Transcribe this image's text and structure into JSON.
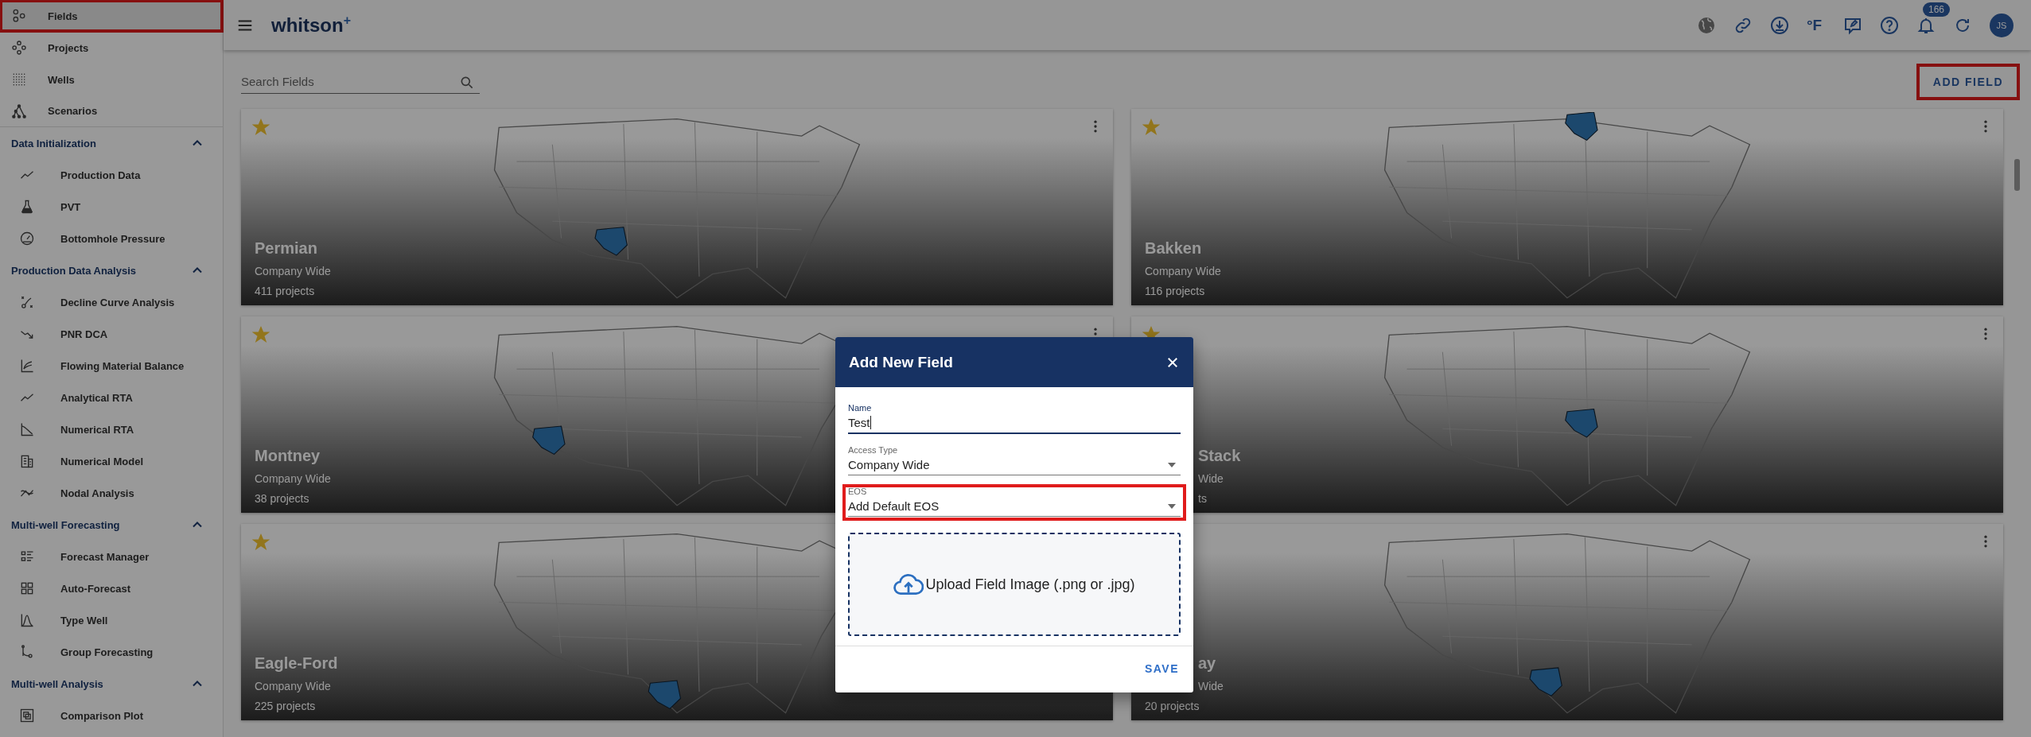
{
  "topbar": {
    "logo": "whitson$^{+}$",
    "units": "°F",
    "notifications": "166",
    "avatar": "JS"
  },
  "sidebar": {
    "top_items": [
      {
        "label": "Fields",
        "selected": true,
        "highlighted": true
      },
      {
        "label": "Projects",
        "selected": false,
        "highlighted": false
      },
      {
        "label": "Wells",
        "selected": false,
        "highlighted": false
      },
      {
        "label": "Scenarios",
        "selected": false,
        "highlighted": false
      }
    ],
    "sections": [
      {
        "title": "Data Initialization",
        "expanded": true,
        "items": [
          {
            "label": "Production Data",
            "selected": false
          },
          {
            "label": "PVT",
            "selected": false
          },
          {
            "label": "Bottomhole Pressure",
            "selected": false
          }
        ]
      },
      {
        "title": "Production Data Analysis",
        "expanded": true,
        "items": [
          {
            "label": "Decline Curve Analysis",
            "selected": false
          },
          {
            "label": "PNR DCA",
            "selected": false
          },
          {
            "label": "Flowing Material Balance",
            "selected": false
          },
          {
            "label": "Analytical RTA",
            "selected": false
          },
          {
            "label": "Numerical RTA",
            "selected": false
          },
          {
            "label": "Numerical Model",
            "selected": false
          },
          {
            "label": "Nodal Analysis",
            "selected": false
          }
        ]
      },
      {
        "title": "Multi-well Forecasting",
        "expanded": true,
        "items": [
          {
            "label": "Forecast Manager",
            "selected": false
          },
          {
            "label": "Auto-Forecast",
            "selected": false
          },
          {
            "label": "Type Well",
            "selected": false
          },
          {
            "label": "Group Forecasting",
            "selected": false
          }
        ]
      },
      {
        "title": "Multi-well Analysis",
        "expanded": true,
        "items": [
          {
            "label": "Comparison Plot",
            "selected": false
          }
        ]
      }
    ]
  },
  "search": {
    "placeholder": "Search Fields"
  },
  "add_button": {
    "label": "ADD FIELD",
    "highlighted": true
  },
  "cards": [
    {
      "starred": true,
      "name": "Permian",
      "access": "Company Wide",
      "projects": "411 projects"
    },
    {
      "starred": true,
      "name": "Bakken",
      "access": "Company Wide",
      "projects": "116 projects"
    },
    {
      "starred": true,
      "name": "Montney",
      "access": "Company Wide",
      "projects": "38 projects"
    },
    {
      "starred": true,
      "name": "Stack",
      "access": "Wide",
      "projects": "ts"
    },
    {
      "starred": true,
      "name": "Eagle-Ford",
      "access": "Company Wide",
      "projects": "225 projects"
    },
    {
      "name": "ay",
      "access": "Wide",
      "projects": "20 projects"
    }
  ],
  "dialog": {
    "title": "Add New Field",
    "fields": [
      {
        "kind": "text",
        "label": "Name",
        "value": "Test",
        "focused": true,
        "highlighted": false
      },
      {
        "kind": "select",
        "label": "Access Type",
        "value": "Company Wide",
        "focused": false,
        "highlighted": false
      },
      {
        "kind": "select",
        "label": "EOS",
        "value": "Add Default EOS",
        "focused": false,
        "highlighted": true
      }
    ],
    "upload": "Upload Field Image (.png or .jpg)",
    "save": "SAVE"
  }
}
